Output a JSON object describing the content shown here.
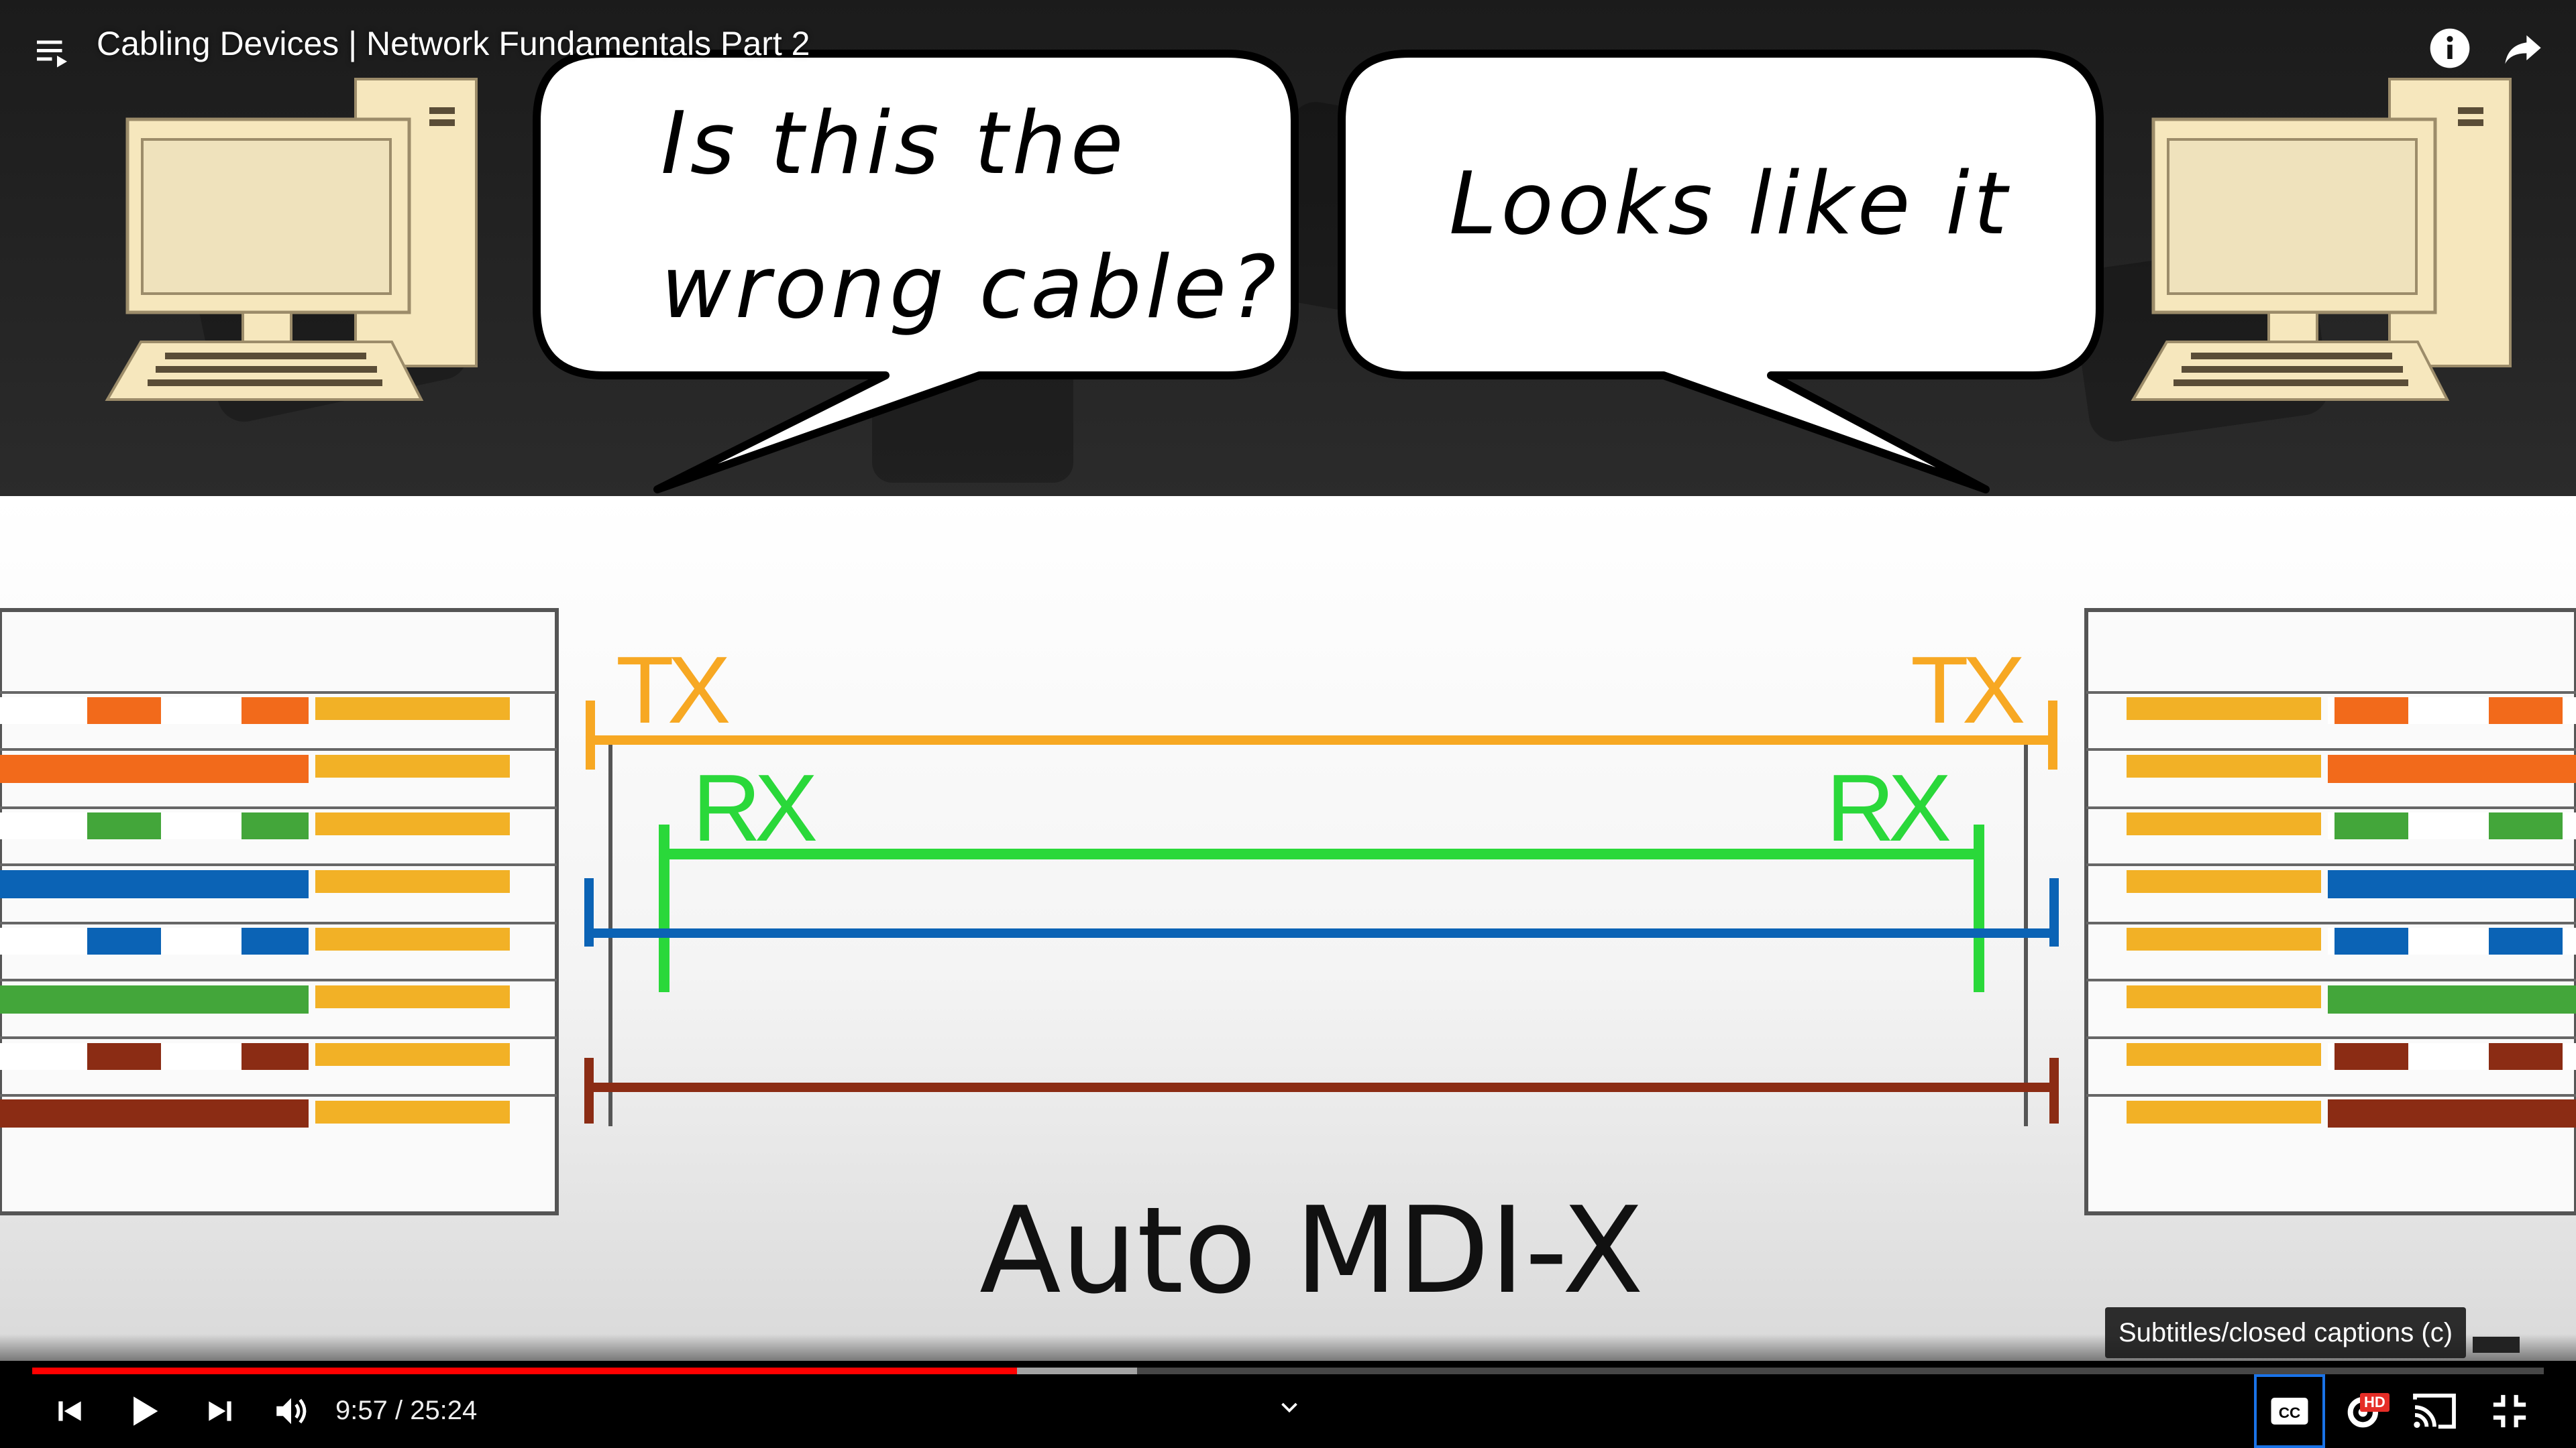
{
  "player": {
    "title": "Cabling Devices | Network Fundamentals Part 2",
    "time": "9:57 / 25:24",
    "progress_played": 0.392,
    "progress_buffered": 0.44,
    "tooltip": "Subtitles/closed captions (c)",
    "hd_badge": "HD",
    "cc_label": "CC"
  },
  "video": {
    "bubble_left": [
      "Is this the",
      "wrong cable?"
    ],
    "bubble_right": "Looks like it",
    "tx_left": "TX",
    "tx_right": "TX",
    "rx_left": "RX",
    "rx_right": "RX",
    "diagram_title": "Auto MDI-X"
  },
  "colors": {
    "tx": "#f7a823",
    "rx": "#2ad83a",
    "blue_pair": "#0b63b5",
    "brown_pair": "#8b2c14",
    "progress": "#ff0000"
  }
}
